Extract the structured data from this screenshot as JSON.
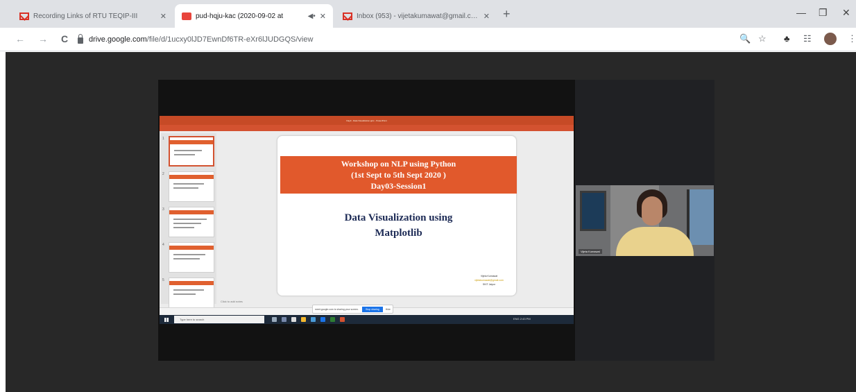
{
  "browser": {
    "tabs": [
      {
        "title": "Recording Links of RTU TEQIP-III",
        "close": "✕"
      },
      {
        "title": "pud-hqju-kac (2020-09-02 at",
        "close": "✕",
        "audio": "◀•"
      },
      {
        "title": "Inbox (953) - vijetakumawat@gmail.com",
        "close": "✕"
      }
    ],
    "new_tab": "+",
    "window_controls": {
      "minimize": "—",
      "restore": "❐",
      "close": "✕"
    },
    "nav": {
      "back": "←",
      "forward": "→",
      "reload": "C"
    },
    "url_host": "drive.google.com",
    "url_path": "/file/d/1ucxy0lJD7EwnDf6TR-eXr6lJUDGQS/view",
    "tools": {
      "zoom": "🔍",
      "star": "☆",
      "puzzle": "♣",
      "reading": "☷",
      "menu": "⋮"
    }
  },
  "presentation": {
    "title_bar": "Day3 - Data Visualization.pptx - PowerPoint",
    "thumbnail_numbers": [
      "1",
      "2",
      "3",
      "4",
      "5"
    ],
    "notes_placeholder": "Click to add notes",
    "slide": {
      "band_lines": [
        "Workshop on NLP using Python",
        "(1st Sept to 5th Sept 2020 )",
        "Day03-Session1"
      ],
      "heading_lines": [
        "Data Visualization using",
        "Matplotlib"
      ],
      "signature": {
        "name": "Vijeta Kumawat",
        "email": "vijetakumawat@gmail.com",
        "dept": "SKIT Jaipur"
      }
    },
    "meet_banner": {
      "text": "meet.google.com is sharing your screen.",
      "stop": "Stop sharing",
      "hide": "Hide"
    },
    "taskbar_search": "Type here to search",
    "tray": "ENG 2:43 PM"
  },
  "participant": {
    "name": "Vijeta Kumawat"
  }
}
